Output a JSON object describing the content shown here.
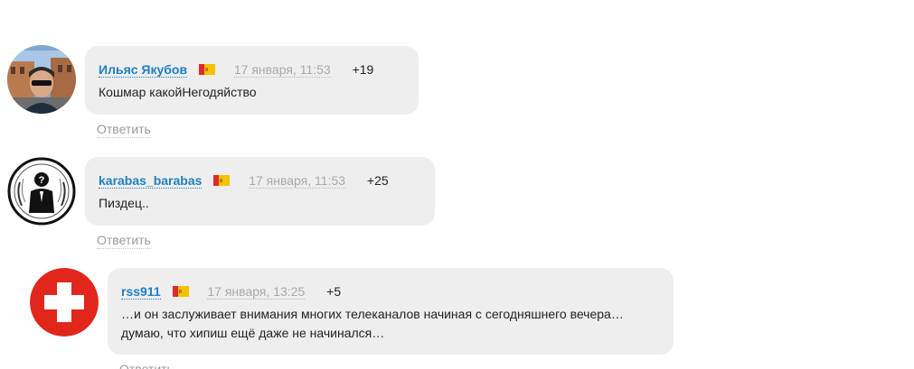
{
  "comments": [
    {
      "author": "Ильяс Якубов",
      "date": "17 января, 11:53",
      "rating": "+19",
      "text": "Кошмар какойНегодяйство",
      "reply_label": "Ответить",
      "avatar_icon": "user-photo-avatar"
    },
    {
      "author": "karabas_barabas",
      "date": "17 января, 11:53",
      "rating": "+25",
      "text": "Пиздец..",
      "reply_label": "Ответить",
      "avatar_icon": "anonymous-mask-avatar"
    },
    {
      "author": "rss911",
      "date": "17 января, 13:25",
      "rating": "+5",
      "text": "…и он заслуживает внимания многих телеканалов начиная с сегодняшнего вечера…\nдумаю, что хипиш ещё даже не начинался…",
      "reply_label": "Ответить",
      "avatar_icon": "red-cross-avatar"
    }
  ],
  "colors": {
    "author_link": "#1e7fc0",
    "bubble_bg": "#eeeeee",
    "date_text": "#a9a9a9",
    "reply_text": "#9a9a9a",
    "cross_red": "#e1261c"
  }
}
